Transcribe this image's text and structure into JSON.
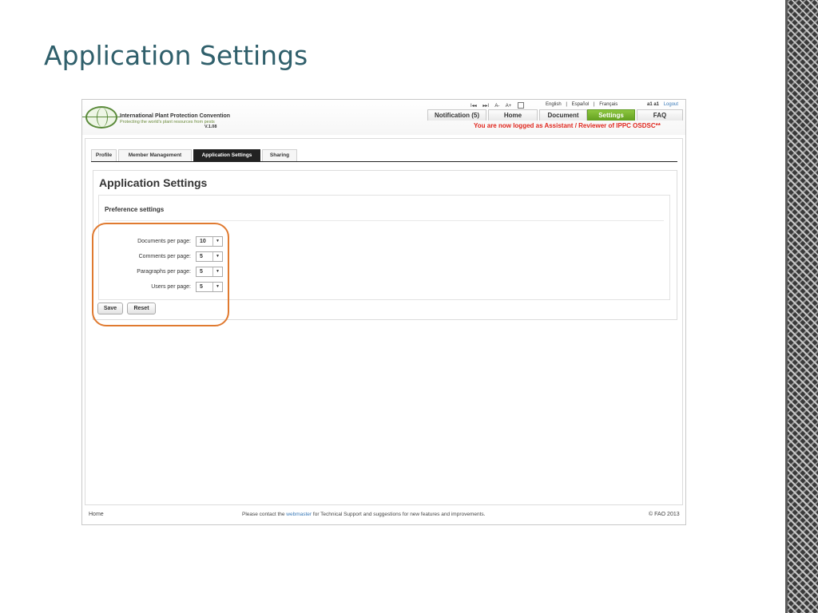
{
  "slide": {
    "title": "Application Settings"
  },
  "header": {
    "org_name": "International Plant Protection Convention",
    "tagline": "Protecting the world's plant resources from pests",
    "version": "V.1.08",
    "tools": {
      "first": "I◂◂",
      "last": "▸▸I",
      "font_smaller": "A-",
      "font_larger": "A+"
    },
    "languages": [
      "English",
      "|",
      "Español",
      "|",
      "Français"
    ],
    "user_name": "a1 a1",
    "logout": "Logout",
    "nav": [
      {
        "label": "Notification (5)"
      },
      {
        "label": "Home"
      },
      {
        "label": "Document"
      },
      {
        "label": "Settings",
        "active": true
      },
      {
        "label": "FAQ"
      }
    ],
    "logged_message": "You are now logged as Assistant / Reviewer of IPPC OSDSC**"
  },
  "tabs": [
    {
      "label": "Profile"
    },
    {
      "label": "Member Management"
    },
    {
      "label": "Application Settings",
      "active": true
    },
    {
      "label": "Sharing"
    }
  ],
  "settings": {
    "title": "Application Settings",
    "section_title": "Preference settings",
    "fields": [
      {
        "label": "Documents per page:",
        "value": "10"
      },
      {
        "label": "Comments per page:",
        "value": "5"
      },
      {
        "label": "Paragraphs per page:",
        "value": "5"
      },
      {
        "label": "Users per page:",
        "value": "5"
      }
    ],
    "save_label": "Save",
    "reset_label": "Reset"
  },
  "footer": {
    "home": "Home",
    "msg_prefix": "Please contact the",
    "link": "webmaster",
    "msg_suffix": "for Technical Support and suggestions for new features and improvements.",
    "copyright": "© FAO 2013"
  },
  "colors": {
    "title": "#2f5f6b",
    "accent_green": "#6aa82a",
    "warning_red": "#e0271e",
    "highlight": "#e07a30",
    "link": "#3a7ab8"
  }
}
